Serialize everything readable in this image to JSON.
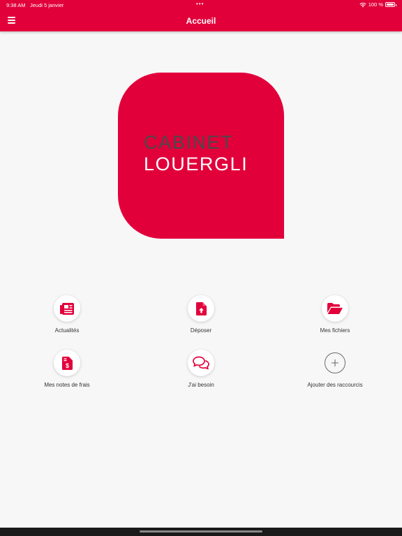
{
  "status": {
    "time": "9:38 AM",
    "date": "Jeudi 5 janvier",
    "dots": "•••",
    "battery": "100 %"
  },
  "nav": {
    "title": "Accueil",
    "menu_icon": "hamburger-icon"
  },
  "logo": {
    "line1": "CABINET",
    "line2": "LOUERGLI"
  },
  "shortcuts": [
    {
      "label": "Actualités",
      "icon": "newspaper-icon"
    },
    {
      "label": "Déposer",
      "icon": "file-upload-icon"
    },
    {
      "label": "Mes fichiers",
      "icon": "folder-open-icon"
    },
    {
      "label": "Mes notes de frais",
      "icon": "expense-file-icon"
    },
    {
      "label": "J'ai besoin",
      "icon": "chat-bubbles-icon"
    },
    {
      "label": "Ajouter des raccourcis",
      "icon": "plus-icon"
    }
  ],
  "colors": {
    "brand": "#e2003b",
    "logo_text_dark": "#4a4a4a",
    "background": "#f7f7f7"
  }
}
